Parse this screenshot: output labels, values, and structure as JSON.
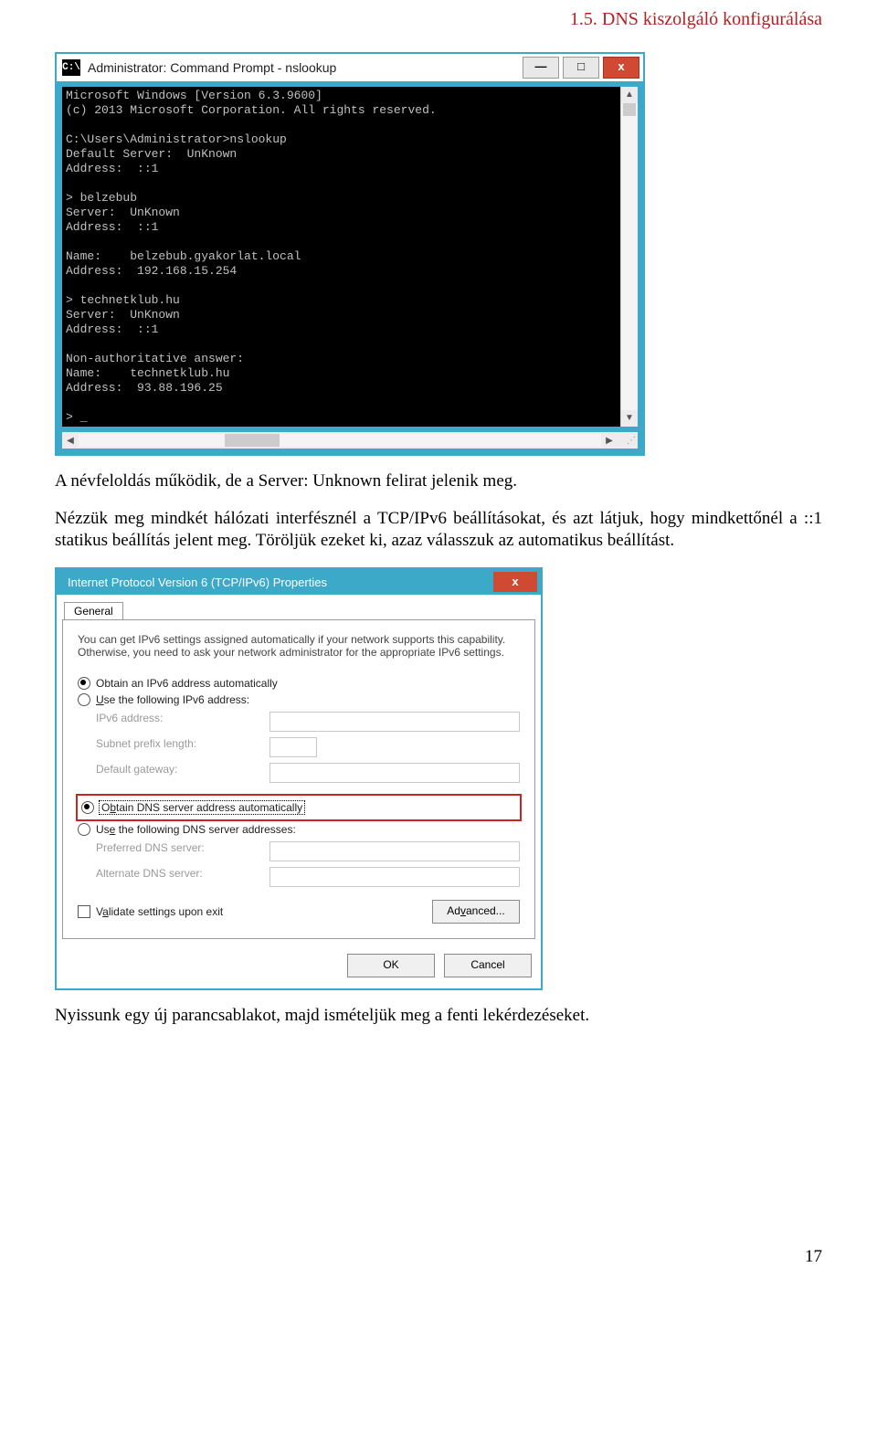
{
  "header": {
    "section_title": "1.5. DNS kiszolgáló konfigurálása"
  },
  "cmd": {
    "icon_label": "C:\\",
    "title": "Administrator: Command Prompt - nslookup",
    "minimize": "—",
    "maximize": "□",
    "close": "x",
    "output": "Microsoft Windows [Version 6.3.9600]\n(c) 2013 Microsoft Corporation. All rights reserved.\n\nC:\\Users\\Administrator>nslookup\nDefault Server:  UnKnown\nAddress:  ::1\n\n> belzebub\nServer:  UnKnown\nAddress:  ::1\n\nName:    belzebub.gyakorlat.local\nAddress:  192.168.15.254\n\n> technetklub.hu\nServer:  UnKnown\nAddress:  ::1\n\nNon-authoritative answer:\nName:    technetklub.hu\nAddress:  93.88.196.25\n\n> _"
  },
  "paragraph1": "A névfeloldás működik, de a Server: Unknown felirat jelenik meg.",
  "paragraph2": "Nézzük meg mindkét hálózati interfésznél a TCP/IPv6 beállításokat, és azt látjuk, hogy mindkettőnél a ::1 statikus beállítás jelent meg. Töröljük ezeket ki, azaz válasszuk az automatikus beállítást.",
  "props": {
    "title": "Internet Protocol Version 6 (TCP/IPv6) Properties",
    "close": "x",
    "tab": "General",
    "help": "You can get IPv6 settings assigned automatically if your network supports this capability. Otherwise, you need to ask your network administrator for the appropriate IPv6 settings.",
    "obtain_addr": "Obtain an IPv6 address automatically",
    "use_addr": "Use the following IPv6 address:",
    "ipv6_address": "IPv6 address:",
    "subnet_prefix": "Subnet prefix length:",
    "default_gateway": "Default gateway:",
    "obtain_dns": "Obtain DNS server address automatically",
    "use_dns": "Use the following DNS server addresses:",
    "pref_dns": "Preferred DNS server:",
    "alt_dns": "Alternate DNS server:",
    "validate": "Validate settings upon exit",
    "advanced": "Advanced...",
    "ok": "OK",
    "cancel": "Cancel"
  },
  "paragraph3": "Nyissunk egy új parancsablakot, majd ismételjük meg a fenti lekérdezéseket.",
  "page_number": "17"
}
